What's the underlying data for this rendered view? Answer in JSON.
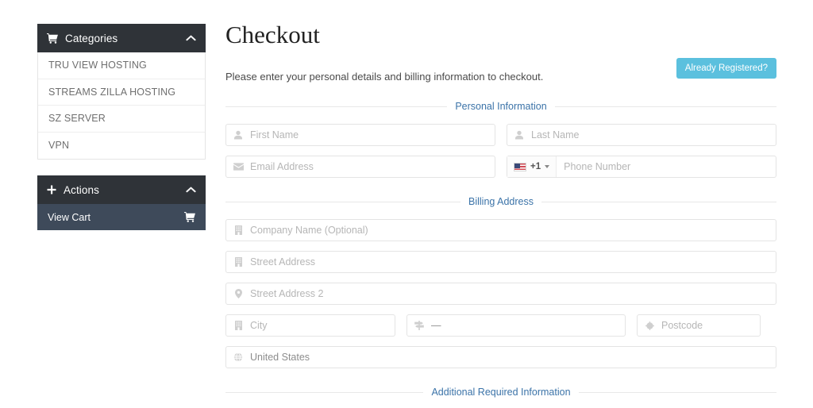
{
  "sidebar": {
    "categories_panel": {
      "title": "Categories",
      "icon": "shopping-cart-icon",
      "collapse_icon": "chevron-up-icon",
      "items": [
        {
          "label": "TRU VIEW HOSTING"
        },
        {
          "label": "STREAMS ZILLA HOSTING"
        },
        {
          "label": "SZ SERVER"
        },
        {
          "label": "VPN"
        }
      ]
    },
    "actions_panel": {
      "title": "Actions",
      "icon": "plus-icon",
      "collapse_icon": "chevron-up-icon",
      "items": [
        {
          "label": "View Cart",
          "icon": "shopping-cart-icon"
        }
      ]
    }
  },
  "main": {
    "title": "Checkout",
    "intro": "Please enter your personal details and billing information to checkout.",
    "registered_button": "Already Registered?",
    "sections": {
      "personal": "Personal Information",
      "billing": "Billing Address",
      "additional": "Additional Required Information"
    },
    "fields": {
      "first_name": {
        "placeholder": "First Name",
        "icon": "user-icon"
      },
      "last_name": {
        "placeholder": "Last Name",
        "icon": "user-icon"
      },
      "email": {
        "placeholder": "Email Address",
        "icon": "envelope-icon"
      },
      "phone": {
        "placeholder": "Phone Number",
        "icon": "flag-icon",
        "dial_code": "+1",
        "country": "United States"
      },
      "company": {
        "placeholder": "Company Name (Optional)",
        "icon": "building-icon"
      },
      "street1": {
        "placeholder": "Street Address",
        "icon": "building-icon"
      },
      "street2": {
        "placeholder": "Street Address 2",
        "icon": "map-marker-icon"
      },
      "city": {
        "placeholder": "City",
        "icon": "building-icon"
      },
      "state": {
        "value": "—",
        "icon": "map-signs-icon"
      },
      "postcode": {
        "placeholder": "Postcode",
        "icon": "circle-icon"
      },
      "country": {
        "value": "United States",
        "icon": "globe-icon"
      }
    }
  },
  "colors": {
    "panel_header": "#2f3338",
    "action_row": "#3e4a5a",
    "accent_blue": "#5bc0de",
    "legend_text": "#3b73a8"
  }
}
